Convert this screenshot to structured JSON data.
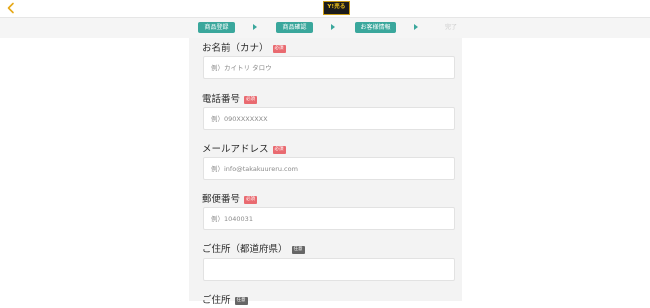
{
  "header": {
    "back_icon": "chevron-left-icon",
    "back_color": "#e6a817",
    "logo_text": "Y!売る"
  },
  "steps": [
    {
      "label": "商品登録",
      "state": "active"
    },
    {
      "label": "商品確認",
      "state": "active"
    },
    {
      "label": "お客様情報",
      "state": "active"
    },
    {
      "label": "完了",
      "state": "inactive"
    }
  ],
  "form": {
    "kana": {
      "label": "お名前（カナ）",
      "badge": "必須",
      "placeholder": "例）カイトリ タロウ",
      "value": ""
    },
    "phone": {
      "label": "電話番号",
      "badge": "必須",
      "placeholder": "例）090XXXXXXX",
      "value": ""
    },
    "email": {
      "label": "メールアドレス",
      "badge": "必須",
      "placeholder": "例）info@takakuureru.com",
      "value": ""
    },
    "zip": {
      "label": "郵便番号",
      "badge": "必須",
      "placeholder": "例）1040031",
      "value": ""
    },
    "prefecture": {
      "label": "ご住所（都道府県）",
      "badge": "任意",
      "placeholder": "",
      "value": ""
    },
    "address": {
      "label": "ご住所",
      "badge": "任意"
    }
  },
  "colors": {
    "accent": "#3aa79c",
    "required": "#e96a70",
    "optional": "#666666"
  }
}
